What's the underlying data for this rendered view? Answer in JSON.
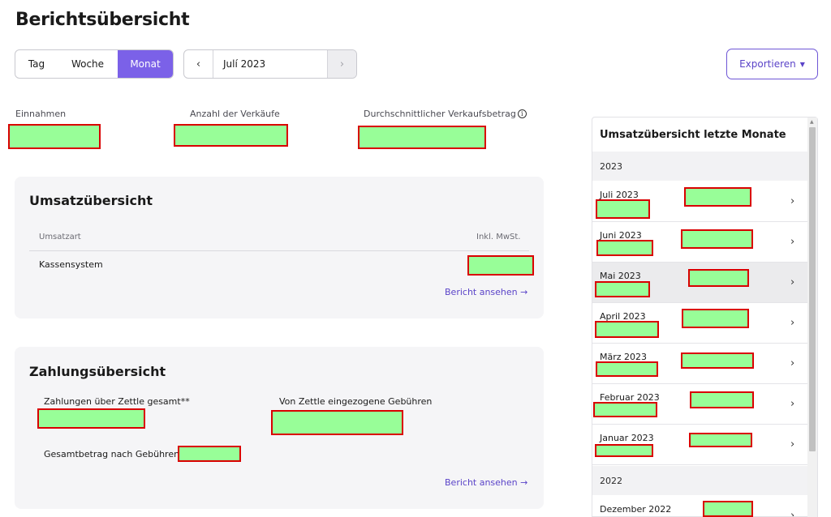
{
  "page": {
    "title": "Berichtsübersicht"
  },
  "period": {
    "tabs": [
      {
        "label": "Tag",
        "active": false
      },
      {
        "label": "Woche",
        "active": false
      },
      {
        "label": "Monat",
        "active": true
      }
    ],
    "selected": "Julí 2023",
    "prev_icon": "chevron-left-icon",
    "next_icon": "chevron-right-icon"
  },
  "export": {
    "label": "Exportieren",
    "icon": "caret-down-icon"
  },
  "kpis": [
    {
      "label": "Einnahmen"
    },
    {
      "label": "Anzahl der Verkäufe"
    },
    {
      "label": "Durchschnittlicher Verkaufsbetrag",
      "icon": "info-icon"
    }
  ],
  "sales_overview": {
    "title": "Umsatzübersicht",
    "columns": [
      "Umsatzart",
      "Inkl. MwSt."
    ],
    "rows": [
      {
        "type": "Kassensystem"
      }
    ],
    "link": "Bericht ansehen →"
  },
  "payment_overview": {
    "title": "Zahlungsübersicht",
    "total_label": "Zahlungen über Zettle gesamt**",
    "fees_label": "Von Zettle eingezogene Gebühren",
    "net_label": "Gesamtbetrag nach Gebühren",
    "link": "Bericht ansehen →"
  },
  "side_panel": {
    "title": "Umsatzübersicht letzte Monate",
    "groups": [
      {
        "year": "2023",
        "months": [
          "Juli 2023",
          "Juni 2023",
          "Mai 2023",
          "April 2023",
          "März 2023",
          "Februar 2023",
          "Januar 2023"
        ],
        "highlighted": "Mai 2023"
      },
      {
        "year": "2022",
        "months": [
          "Dezember 2022"
        ]
      }
    ]
  },
  "colors": {
    "accent": "#7b61e8",
    "link": "#5a43c8",
    "card_bg": "#f5f5f7",
    "redaction_fill": "#98fe98",
    "redaction_border": "#d90000"
  }
}
